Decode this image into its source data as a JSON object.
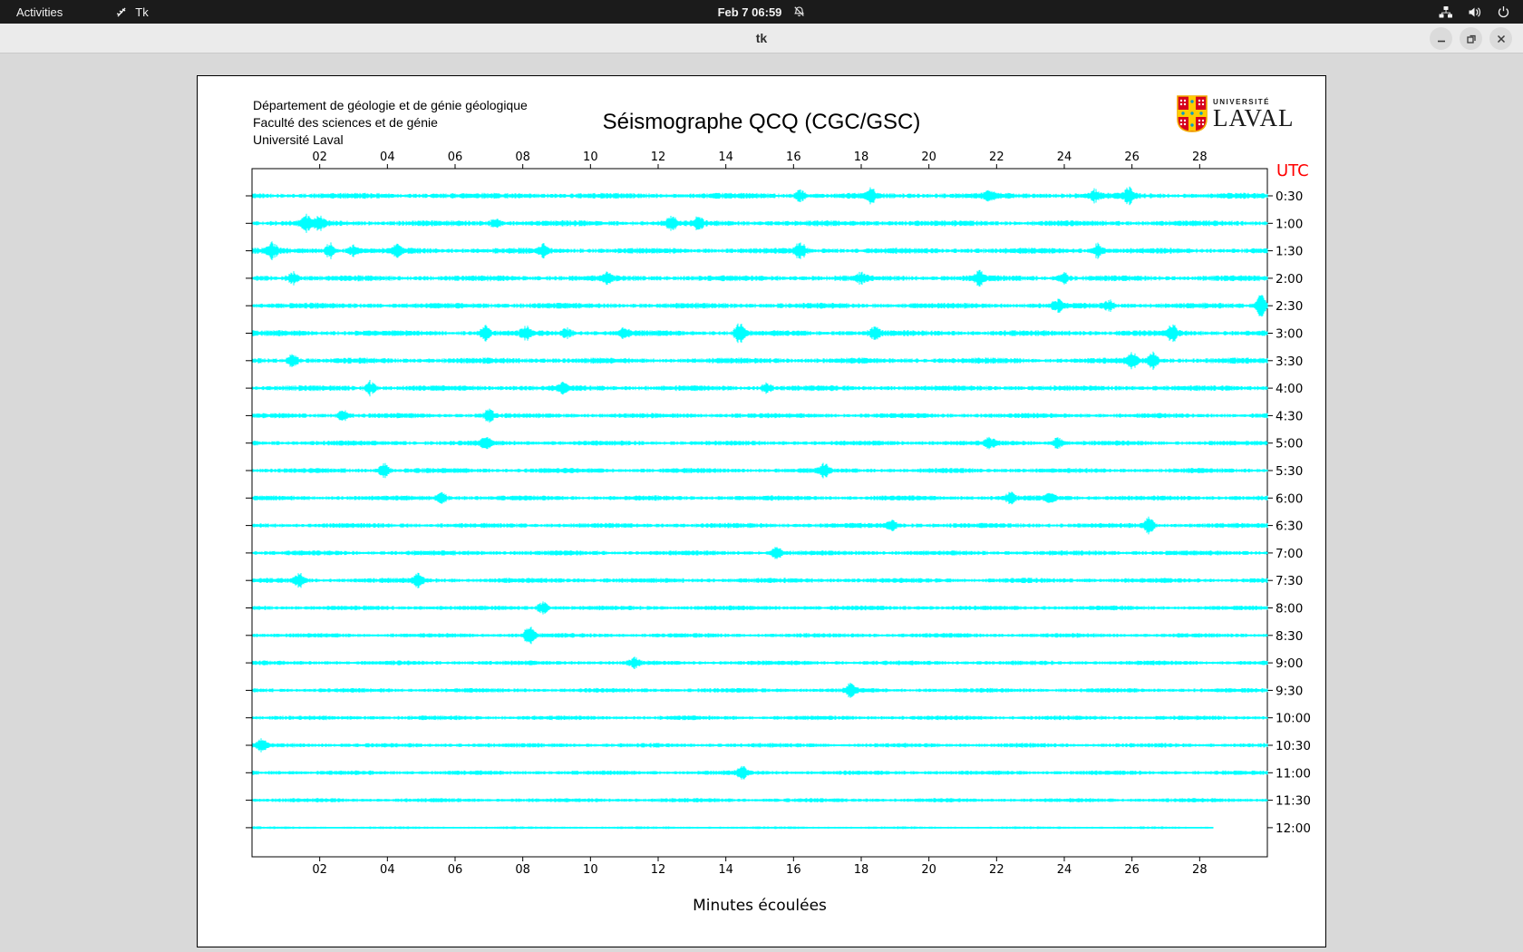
{
  "top_bar": {
    "activities": "Activities",
    "app_name": "Tk",
    "clock": "Feb 7  06:59",
    "status_icons": [
      "network",
      "volume",
      "power"
    ]
  },
  "title_bar": {
    "title": "tk"
  },
  "canvas": {
    "header_lines": [
      "Département de géologie et de génie géologique",
      "Faculté des sciences et de génie",
      "Université Laval"
    ],
    "title": "Séismographe QCQ (CGC/GSC)",
    "logo": {
      "univ": "UNIVERSITÉ",
      "name": "LAVAL"
    }
  },
  "chart_data": {
    "type": "line",
    "subtype": "helicorder-seismogram",
    "title": "Séismographe QCQ (CGC/GSC)",
    "xlabel": "Minutes écoulées",
    "x_range": [
      0,
      30
    ],
    "x_ticks": [
      "02",
      "04",
      "06",
      "08",
      "10",
      "12",
      "14",
      "16",
      "18",
      "20",
      "22",
      "24",
      "26",
      "28"
    ],
    "y_axis_right_label": "UTC",
    "trace_color": "#00ffff",
    "utc_label_color": "#ff0000",
    "traces": [
      {
        "label": "0:30",
        "amp": 1.1,
        "events": [
          {
            "m": 16.2,
            "a": 2.0
          },
          {
            "m": 18.3,
            "a": 2.5
          },
          {
            "m": 21.8,
            "a": 2.0
          },
          {
            "m": 24.9,
            "a": 2.0
          },
          {
            "m": 25.9,
            "a": 3.0
          }
        ]
      },
      {
        "label": "1:00",
        "amp": 1.1,
        "events": [
          {
            "m": 1.6,
            "a": 3.0
          },
          {
            "m": 2.0,
            "a": 2.5
          },
          {
            "m": 7.2,
            "a": 2.0
          },
          {
            "m": 12.4,
            "a": 2.5
          },
          {
            "m": 13.2,
            "a": 2.0
          }
        ]
      },
      {
        "label": "1:30",
        "amp": 1.1,
        "events": [
          {
            "m": 0.6,
            "a": 3.0
          },
          {
            "m": 2.3,
            "a": 2.5
          },
          {
            "m": 3.0,
            "a": 2.0
          },
          {
            "m": 4.3,
            "a": 2.0
          },
          {
            "m": 8.6,
            "a": 2.5
          },
          {
            "m": 16.2,
            "a": 3.0
          },
          {
            "m": 25.0,
            "a": 2.5
          }
        ]
      },
      {
        "label": "2:00",
        "amp": 1.1,
        "events": [
          {
            "m": 1.2,
            "a": 2.5
          },
          {
            "m": 10.5,
            "a": 2.0
          },
          {
            "m": 18.0,
            "a": 1.8
          },
          {
            "m": 21.5,
            "a": 2.5
          },
          {
            "m": 24.0,
            "a": 2.0
          }
        ]
      },
      {
        "label": "2:30",
        "amp": 1.1,
        "events": [
          {
            "m": 23.8,
            "a": 2.0
          },
          {
            "m": 25.3,
            "a": 2.0
          },
          {
            "m": 29.8,
            "a": 4.0
          }
        ]
      },
      {
        "label": "3:00",
        "amp": 1.1,
        "events": [
          {
            "m": 6.9,
            "a": 2.5
          },
          {
            "m": 8.1,
            "a": 2.5
          },
          {
            "m": 9.3,
            "a": 2.0
          },
          {
            "m": 11.0,
            "a": 2.0
          },
          {
            "m": 14.4,
            "a": 3.5
          },
          {
            "m": 18.4,
            "a": 2.5
          },
          {
            "m": 27.2,
            "a": 3.5
          }
        ]
      },
      {
        "label": "3:30",
        "amp": 1.1,
        "events": [
          {
            "m": 1.2,
            "a": 2.5
          },
          {
            "m": 26.0,
            "a": 3.0
          },
          {
            "m": 26.6,
            "a": 3.0
          }
        ]
      },
      {
        "label": "4:00",
        "amp": 1.05,
        "events": [
          {
            "m": 3.5,
            "a": 2.5
          },
          {
            "m": 9.2,
            "a": 2.0
          },
          {
            "m": 15.2,
            "a": 2.0
          }
        ]
      },
      {
        "label": "4:30",
        "amp": 0.95,
        "events": [
          {
            "m": 2.7,
            "a": 2.0
          },
          {
            "m": 7.0,
            "a": 2.5
          }
        ]
      },
      {
        "label": "5:00",
        "amp": 0.95,
        "events": [
          {
            "m": 6.9,
            "a": 2.0
          },
          {
            "m": 21.8,
            "a": 2.0
          },
          {
            "m": 23.8,
            "a": 2.0
          }
        ]
      },
      {
        "label": "5:30",
        "amp": 0.95,
        "events": [
          {
            "m": 3.9,
            "a": 2.5
          },
          {
            "m": 16.9,
            "a": 2.5
          }
        ]
      },
      {
        "label": "6:00",
        "amp": 0.95,
        "events": [
          {
            "m": 5.6,
            "a": 2.0
          },
          {
            "m": 22.4,
            "a": 2.0
          },
          {
            "m": 23.6,
            "a": 2.0
          }
        ]
      },
      {
        "label": "6:30",
        "amp": 0.95,
        "events": [
          {
            "m": 18.9,
            "a": 2.0
          },
          {
            "m": 26.5,
            "a": 3.5
          }
        ]
      },
      {
        "label": "7:00",
        "amp": 0.95,
        "events": [
          {
            "m": 15.5,
            "a": 2.5
          }
        ]
      },
      {
        "label": "7:30",
        "amp": 0.95,
        "events": [
          {
            "m": 1.4,
            "a": 2.5
          },
          {
            "m": 4.9,
            "a": 2.5
          }
        ]
      },
      {
        "label": "8:00",
        "amp": 0.9,
        "events": [
          {
            "m": 8.6,
            "a": 2.5
          }
        ]
      },
      {
        "label": "8:30",
        "amp": 0.85,
        "events": [
          {
            "m": 8.2,
            "a": 4.0
          }
        ]
      },
      {
        "label": "9:00",
        "amp": 0.85,
        "events": [
          {
            "m": 11.3,
            "a": 2.0
          }
        ]
      },
      {
        "label": "9:30",
        "amp": 0.85,
        "events": [
          {
            "m": 17.7,
            "a": 2.5
          }
        ]
      },
      {
        "label": "10:00",
        "amp": 0.85,
        "events": []
      },
      {
        "label": "10:30",
        "amp": 0.85,
        "events": [
          {
            "m": 0.3,
            "a": 2.5
          }
        ]
      },
      {
        "label": "11:00",
        "amp": 0.85,
        "events": [
          {
            "m": 14.5,
            "a": 2.5
          }
        ]
      },
      {
        "label": "11:30",
        "amp": 0.8,
        "events": []
      },
      {
        "label": "12:00",
        "amp": 0.5,
        "end": 28.4,
        "events": []
      }
    ]
  }
}
